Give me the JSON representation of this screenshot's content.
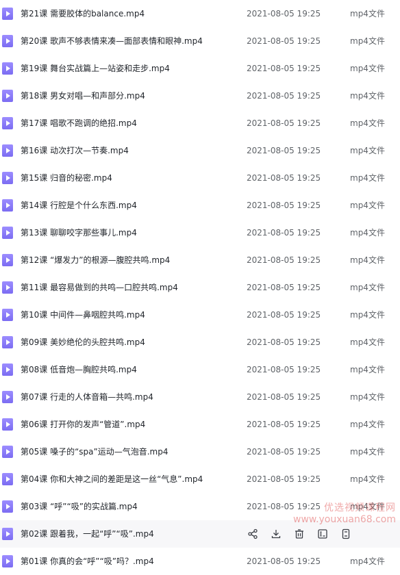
{
  "files": [
    {
      "name": "第21课 需要胶体的balance.mp4",
      "date": "2021-08-05 19:25",
      "type": "mp4文件"
    },
    {
      "name": "第20课 歌声不够表情来凑—面部表情和眼神.mp4",
      "date": "2021-08-05 19:25",
      "type": "mp4文件"
    },
    {
      "name": "第19课 舞台实战篇上—站姿和走步.mp4",
      "date": "2021-08-05 19:25",
      "type": "mp4文件"
    },
    {
      "name": "第18课 男女对唱—和声部分.mp4",
      "date": "2021-08-05 19:25",
      "type": "mp4文件"
    },
    {
      "name": "第17课 唱歌不跑调的绝招.mp4",
      "date": "2021-08-05 19:25",
      "type": "mp4文件"
    },
    {
      "name": "第16课 动次打次—节奏.mp4",
      "date": "2021-08-05 19:25",
      "type": "mp4文件"
    },
    {
      "name": "第15课 归音的秘密.mp4",
      "date": "2021-08-05 19:25",
      "type": "mp4文件"
    },
    {
      "name": "第14课 行腔是个什么东西.mp4",
      "date": "2021-08-05 19:25",
      "type": "mp4文件"
    },
    {
      "name": "第13课 聊聊咬字那些事儿.mp4",
      "date": "2021-08-05 19:25",
      "type": "mp4文件"
    },
    {
      "name": "第12课 “爆发力”的根源—腹腔共鸣.mp4",
      "date": "2021-08-05 19:25",
      "type": "mp4文件"
    },
    {
      "name": "第11课 最容易做到的共鸣—口腔共鸣.mp4",
      "date": "2021-08-05 19:25",
      "type": "mp4文件"
    },
    {
      "name": "第10课 中间件—鼻咽腔共鸣.mp4",
      "date": "2021-08-05 19:25",
      "type": "mp4文件"
    },
    {
      "name": "第09课 美妙绝伦的头腔共鸣.mp4",
      "date": "2021-08-05 19:25",
      "type": "mp4文件"
    },
    {
      "name": "第08课 低音炮—胸腔共鸣.mp4",
      "date": "2021-08-05 19:25",
      "type": "mp4文件"
    },
    {
      "name": "第07课 行走的人体音箱—共鸣.mp4",
      "date": "2021-08-05 19:25",
      "type": "mp4文件"
    },
    {
      "name": "第06课 打开你的发声“管道”.mp4",
      "date": "2021-08-05 19:25",
      "type": "mp4文件"
    },
    {
      "name": "第05课 嗓子的“spa”运动—气泡音.mp4",
      "date": "2021-08-05 19:25",
      "type": "mp4文件"
    },
    {
      "name": "第04课 你和大神之间的差距是这一丝“气息”.mp4",
      "date": "2021-08-05 19:25",
      "type": "mp4文件"
    },
    {
      "name": "第03课 “呼”“吸”的实战篇.mp4",
      "date": "2021-08-05 19:25",
      "type": "mp4文件"
    },
    {
      "name": "第02课 跟着我，一起“呼”“吸”.mp4",
      "date": "",
      "type": "",
      "hovered": true
    },
    {
      "name": "第01课 你真的会“呼”“吸”吗？.mp4",
      "date": "2021-08-05 19:25",
      "type": "mp4文件"
    }
  ],
  "row_actions": [
    {
      "icon": "share-icon"
    },
    {
      "icon": "download-icon"
    },
    {
      "icon": "delete-icon"
    },
    {
      "icon": "rename-icon"
    },
    {
      "icon": "more-icon"
    }
  ],
  "watermark": {
    "line1": "优选视频课程网",
    "line2": "www.youxuan68.com"
  }
}
